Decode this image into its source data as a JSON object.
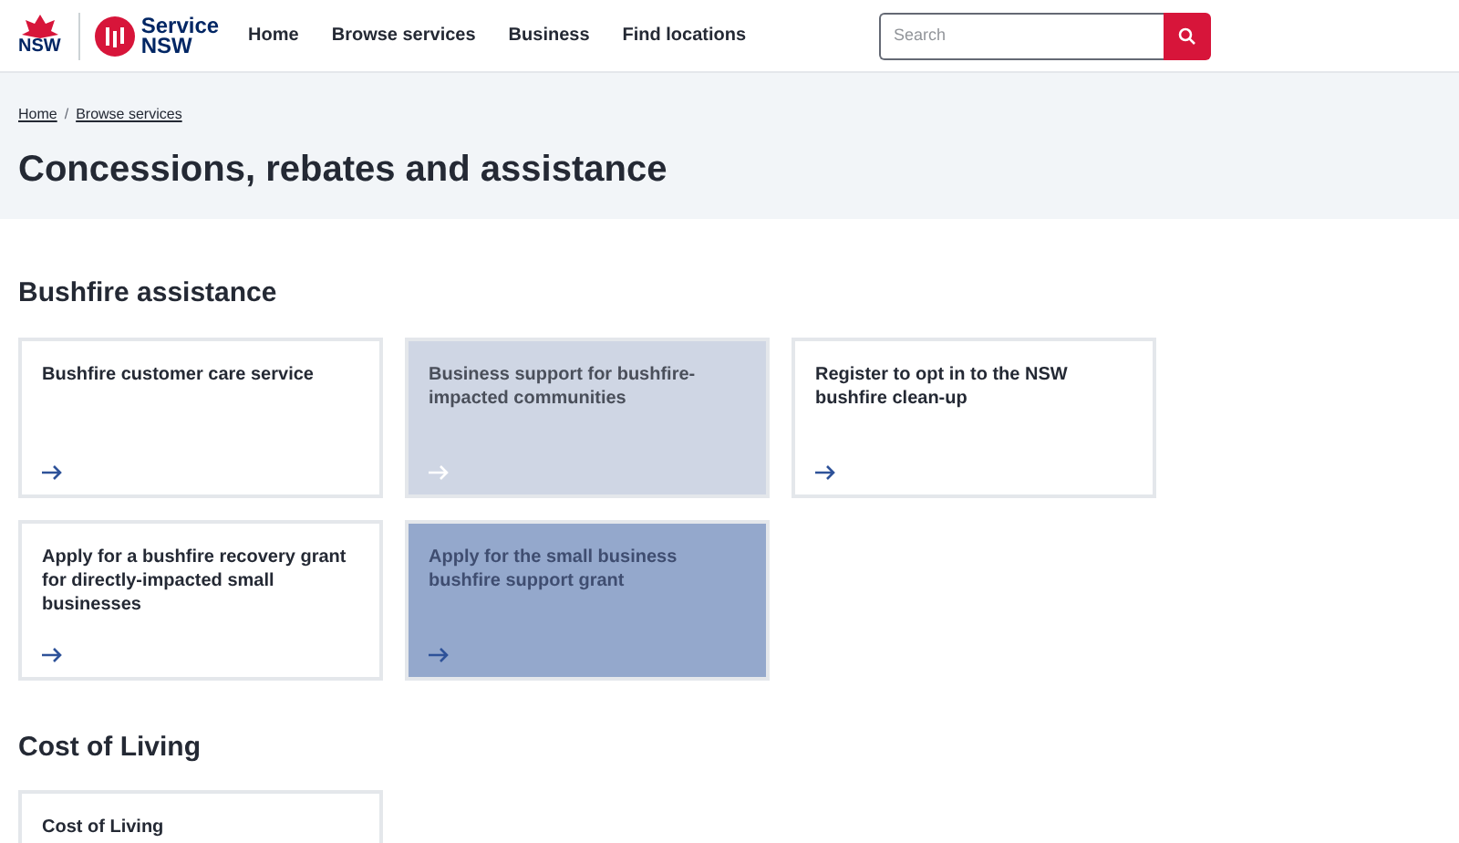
{
  "header": {
    "gov_logo": "NSW",
    "brand": [
      "Service",
      "NSW"
    ],
    "nav": [
      "Home",
      "Browse services",
      "Business",
      "Find locations"
    ],
    "search": {
      "placeholder": "Search"
    }
  },
  "breadcrumbs": {
    "items": [
      "Home",
      "Browse services"
    ],
    "separator": "/"
  },
  "page_title": "Concessions, rebates and assistance",
  "sections": [
    {
      "heading": "Bushfire assistance",
      "cards": [
        {
          "title": "Bushfire customer care service",
          "kind": "default"
        },
        {
          "title": "Business support for bushfire-impacted communities",
          "kind": "hover"
        },
        {
          "title": "Register to opt in to the NSW bushfire clean-up",
          "kind": "default"
        },
        {
          "title": "Apply for a bushfire recovery grant for directly-impacted small businesses",
          "kind": "default"
        },
        {
          "title": "Apply for the small business bushfire support grant",
          "kind": "pressed"
        }
      ]
    },
    {
      "heading": "Cost of Living",
      "cards": [
        {
          "title": "Cost of Living",
          "kind": "default"
        }
      ]
    }
  ]
}
